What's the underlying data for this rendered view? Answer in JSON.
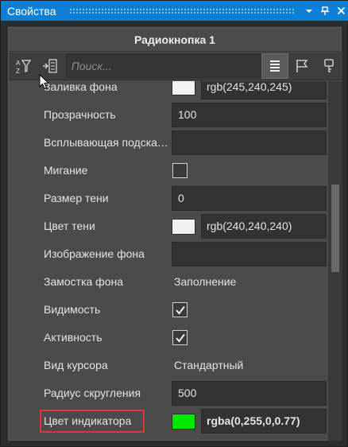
{
  "window": {
    "title": "Свойства",
    "pin_icon": "pin-icon",
    "close_icon": "close-icon",
    "dropdown_icon": "chevron-down-icon"
  },
  "panel": {
    "header": "Радиокнопка 1"
  },
  "toolbar": {
    "search_placeholder": "Поиск...",
    "buttons": [
      "sort-alpha-icon",
      "events-list-icon",
      "properties-list-icon",
      "flag-icon",
      "key-icon"
    ]
  },
  "properties": [
    {
      "label": "Заливка фона",
      "type": "color",
      "swatch": "#f5f0f5",
      "value": "rgb(245,240,245)"
    },
    {
      "label": "Прозрачность",
      "type": "text",
      "value": "100"
    },
    {
      "label": "Всплывающая подсказка",
      "type": "text",
      "value": ""
    },
    {
      "label": "Мигание",
      "type": "checkbox",
      "checked": false
    },
    {
      "label": "Размер тени",
      "type": "text",
      "value": "0"
    },
    {
      "label": "Цвет тени",
      "type": "color",
      "swatch": "#f0f0f0",
      "value": "rgb(240,240,240)"
    },
    {
      "label": "Изображение фона",
      "type": "text",
      "value": ""
    },
    {
      "label": "Замостка фона",
      "type": "plain",
      "value": "Заполнение"
    },
    {
      "label": "Видимость",
      "type": "checkbox",
      "checked": true
    },
    {
      "label": "Активность",
      "type": "checkbox",
      "checked": true
    },
    {
      "label": "Вид курсора",
      "type": "plain",
      "value": "Стандартный"
    },
    {
      "label": "Радиус скругления",
      "type": "text",
      "value": "500"
    },
    {
      "label": "Цвет индикатора",
      "type": "color",
      "swatch": "#00ff00",
      "value": "rgba(0,255,0,0.77)",
      "highlight": true,
      "bold": true
    }
  ],
  "colors": {
    "title_bar": "#0e7fd6",
    "highlight": "#e0353b"
  }
}
